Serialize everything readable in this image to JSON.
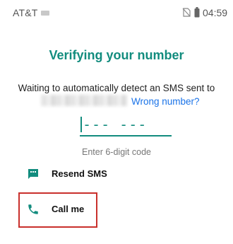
{
  "status_bar": {
    "carrier": "AT&T",
    "time": "04:59",
    "icons": [
      "notification-icon",
      "no-sim-icon",
      "battery-icon"
    ]
  },
  "page": {
    "title": "Verifying your number",
    "description": "Waiting to automatically detect an SMS sent to",
    "wrong_number_link": "Wrong number?",
    "code_placeholder": "--- ---",
    "code_hint": "Enter 6-digit code"
  },
  "options": {
    "resend_sms": {
      "label": "Resend SMS",
      "icon": "message-icon"
    },
    "call_me": {
      "label": "Call me",
      "icon": "phone-icon"
    }
  },
  "colors": {
    "accent": "#128c7e",
    "link": "#1a73e8",
    "highlight_border": "#c9302c"
  }
}
